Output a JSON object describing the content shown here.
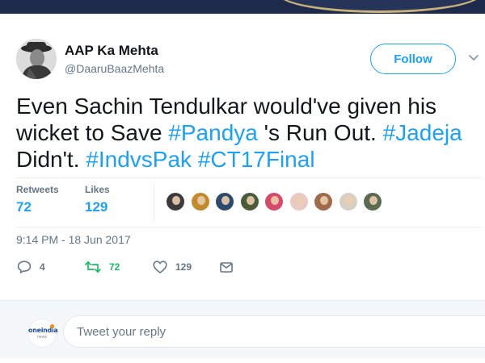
{
  "author": {
    "name": "AAP Ka Mehta",
    "handle": "@DaaruBaazMehta",
    "follow_label": "Follow"
  },
  "tweet": {
    "segments": [
      {
        "text": "Even Sachin Tendulkar would've given his wicket to Save ",
        "type": "text"
      },
      {
        "text": "#Pandya",
        "type": "hashtag"
      },
      {
        "text": " 's Run Out. ",
        "type": "text"
      },
      {
        "text": "#Jadeja",
        "type": "hashtag"
      },
      {
        "text": " Didn't. ",
        "type": "text"
      },
      {
        "text": "#IndvsPak",
        "type": "hashtag"
      },
      {
        "text": " ",
        "type": "text"
      },
      {
        "text": "#CT17Final",
        "type": "hashtag"
      }
    ]
  },
  "stats": {
    "retweets_label": "Retweets",
    "retweets_value": "72",
    "likes_label": "Likes",
    "likes_value": "129",
    "liker_avatars": [
      {
        "color": "#3b3b3b"
      },
      {
        "color": "#c28a2e"
      },
      {
        "color": "#2e4a6b"
      },
      {
        "color": "#4a5d3a"
      },
      {
        "color": "#d64a6a"
      },
      {
        "color": "#e9c9c2"
      },
      {
        "color": "#a06b4a"
      },
      {
        "color": "#d9d0c4"
      },
      {
        "color": "#5c6a50"
      }
    ]
  },
  "timestamp": "9:14 PM - 18 Jun 2017",
  "actions": {
    "reply_count": "4",
    "retweet_count": "72",
    "like_count": "129"
  },
  "reply": {
    "placeholder": "Tweet your reply",
    "avatar_brand": "oneindia",
    "avatar_brand_sub": "news"
  },
  "colors": {
    "accent": "#1da1f2",
    "retweet_green": "#17bf63",
    "muted": "#657786",
    "text": "#14171a"
  }
}
